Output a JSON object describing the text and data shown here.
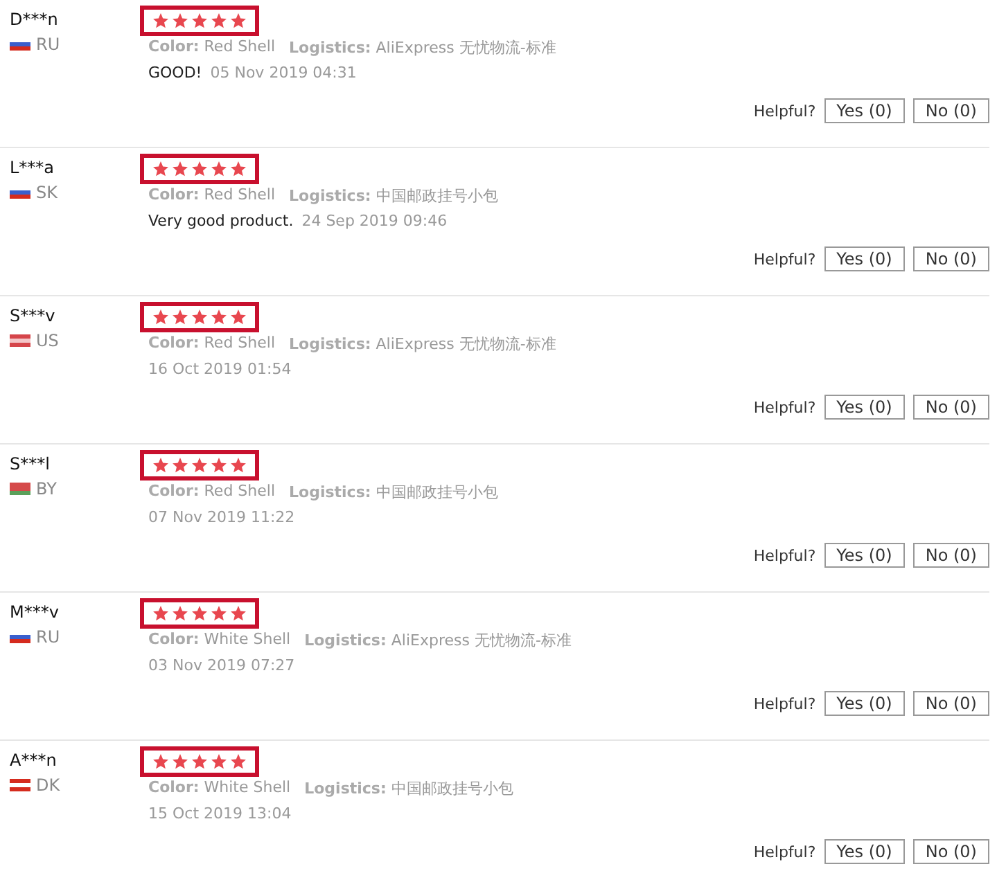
{
  "reviews": [
    {
      "user": "D***n",
      "country": "RU",
      "flag": {
        "kind": "tricolor"
      },
      "stars": 5,
      "color_label": "Color:",
      "color_value": "Red Shell",
      "logistics_label": "Logistics:",
      "logistics": "AliExpress 无忧物流-标准",
      "comment": "GOOD!",
      "date": "05 Nov 2019 04:31",
      "helpful": "Helpful?",
      "yes": "Yes (0)",
      "no": "No (0)"
    },
    {
      "user": "L***a",
      "country": "SK",
      "flag": {
        "kind": "tricolor"
      },
      "stars": 5,
      "color_label": "Color:",
      "color_value": "Red Shell",
      "logistics_label": "Logistics:",
      "logistics": "中国邮政挂号小包",
      "comment": "Very good product.",
      "date": "24 Sep 2019 09:46",
      "helpful": "Helpful?",
      "yes": "Yes (0)",
      "no": "No (0)"
    },
    {
      "user": "S***v",
      "country": "US",
      "flag": {
        "kind": "stripes"
      },
      "stars": 5,
      "color_label": "Color:",
      "color_value": "Red Shell",
      "logistics_label": "Logistics:",
      "logistics": "AliExpress 无忧物流-标准",
      "date": "16 Oct 2019 01:54",
      "helpful": "Helpful?",
      "yes": "Yes (0)",
      "no": "No (0)"
    },
    {
      "user": "S***l",
      "country": "BY",
      "flag": {
        "kind": "bicolor"
      },
      "stars": 5,
      "color_label": "Color:",
      "color_value": "Red Shell",
      "logistics_label": "Logistics:",
      "logistics": "中国邮政挂号小包",
      "date": "07 Nov 2019 11:22",
      "helpful": "Helpful?",
      "yes": "Yes (0)",
      "no": "No (0)"
    },
    {
      "user": "M***v",
      "country": "RU",
      "flag": {
        "kind": "tricolor"
      },
      "stars": 5,
      "color_label": "Color:",
      "color_value": "White Shell",
      "logistics_label": "Logistics:",
      "logistics": "AliExpress 无忧物流-标准",
      "date": "03 Nov 2019 07:27",
      "helpful": "Helpful?",
      "yes": "Yes (0)",
      "no": "No (0)"
    },
    {
      "user": "A***n",
      "country": "DK",
      "flag": {
        "kind": "cross"
      },
      "stars": 5,
      "color_label": "Color:",
      "color_value": "White Shell",
      "logistics_label": "Logistics:",
      "logistics": "中国邮政挂号小包",
      "date": "15 Oct 2019 13:04",
      "helpful": "Helpful?",
      "yes": "Yes (0)",
      "no": "No (0)"
    }
  ]
}
